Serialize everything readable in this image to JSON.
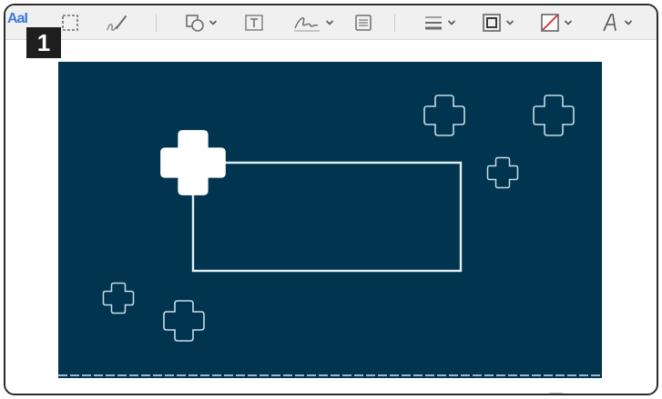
{
  "toolbar": {
    "text_style_label": "AaI",
    "tools": [
      {
        "name": "selection-tool",
        "icon": "dashed-rect-icon"
      },
      {
        "name": "sketch-tool",
        "icon": "pen-icon"
      },
      {
        "name": "shapes-tool",
        "icon": "shapes-icon",
        "has_menu": true
      },
      {
        "name": "text-box-tool",
        "icon": "text-box-icon"
      },
      {
        "name": "sign-tool",
        "icon": "signature-icon",
        "has_menu": true
      },
      {
        "name": "note-tool",
        "icon": "note-icon"
      },
      {
        "name": "shape-style-tool",
        "icon": "lines-icon",
        "has_menu": true
      },
      {
        "name": "border-color-tool",
        "icon": "border-color-icon",
        "has_menu": true
      },
      {
        "name": "fill-color-tool",
        "icon": "fill-color-icon",
        "has_menu": true
      },
      {
        "name": "text-style-tool",
        "icon": "font-icon",
        "has_menu": true
      }
    ]
  },
  "step_badge": "1",
  "artwork": {
    "background_color": "#01344f",
    "outline_color": "#c8dbe8",
    "accent_color": "#ffffff"
  }
}
